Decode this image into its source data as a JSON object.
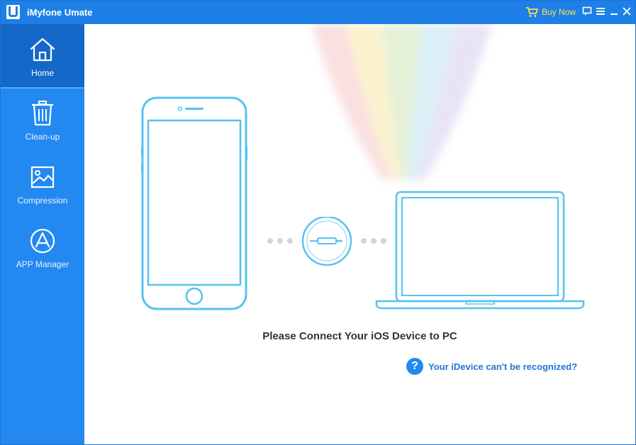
{
  "app": {
    "title": "iMyfone Umate",
    "logo_letter": "U"
  },
  "titlebar": {
    "buy_now_label": "Buy Now",
    "icons": [
      "cart-icon",
      "feedback-icon",
      "menu-icon",
      "minimize-icon",
      "close-icon"
    ]
  },
  "sidebar": {
    "items": [
      {
        "label": "Home",
        "icon": "home-icon",
        "active": true
      },
      {
        "label": "Clean-up",
        "icon": "trash-icon",
        "active": false
      },
      {
        "label": "Compression",
        "icon": "image-icon",
        "active": false
      },
      {
        "label": "APP Manager",
        "icon": "app-store-icon",
        "active": false
      }
    ]
  },
  "main": {
    "connect_message": "Please Connect Your iOS Device to PC",
    "help_link": "Your iDevice can't be recognized?",
    "help_icon": "?"
  },
  "colors": {
    "titlebar": "#1e80e6",
    "sidebar": "#2389f0",
    "sidebar_active": "#1468c7",
    "device_outline": "#55c2f0",
    "buy_now": "#ffe14d",
    "link": "#1f77d6"
  }
}
